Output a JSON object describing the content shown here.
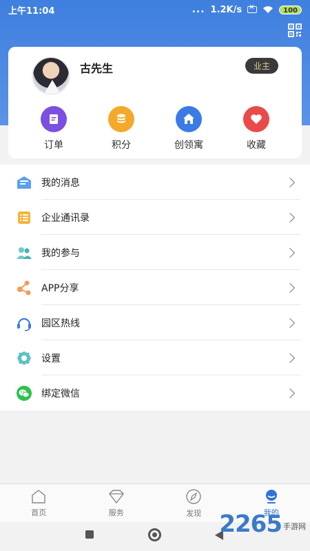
{
  "status_bar": {
    "time": "上午11:04",
    "dots": "...",
    "speed": "1.2K/s",
    "battery": "100"
  },
  "user": {
    "name": "古先生",
    "role": "业主"
  },
  "quick_actions": [
    {
      "label": "订单",
      "icon": "order-icon",
      "color": "#7b4fe0"
    },
    {
      "label": "积分",
      "icon": "coins-icon",
      "color": "#f4a92a"
    },
    {
      "label": "创领寓",
      "icon": "home-icon",
      "color": "#3b7be6"
    },
    {
      "label": "收藏",
      "icon": "heart-icon",
      "color": "#e94b4b"
    }
  ],
  "menu": [
    {
      "label": "我的消息",
      "icon": "message-icon"
    },
    {
      "label": "企业通讯录",
      "icon": "contacts-icon"
    },
    {
      "label": "我的参与",
      "icon": "participation-icon"
    },
    {
      "label": "APP分享",
      "icon": "share-icon"
    },
    {
      "label": "园区热线",
      "icon": "headset-icon"
    },
    {
      "label": "设置",
      "icon": "settings-icon"
    },
    {
      "label": "绑定微信",
      "icon": "wechat-icon"
    }
  ],
  "tabs": [
    {
      "label": "首页",
      "icon": "home-outline-icon",
      "active": false
    },
    {
      "label": "服务",
      "icon": "diamond-icon",
      "active": false
    },
    {
      "label": "发现",
      "icon": "compass-icon",
      "active": false
    },
    {
      "label": "我的",
      "icon": "profile-icon",
      "active": true
    }
  ],
  "watermark": {
    "number": "2265",
    "text": "手游网"
  },
  "colors": {
    "header_blue": "#3f7fde",
    "active_tab": "#2f73d8"
  }
}
